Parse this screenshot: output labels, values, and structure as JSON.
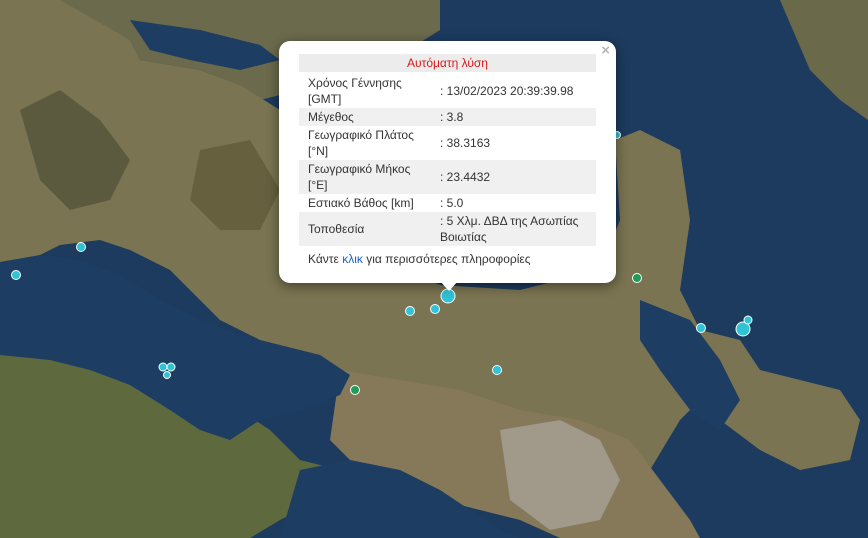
{
  "popup": {
    "title": "Αυτόματη λύση",
    "close_icon": "×",
    "rows": [
      {
        "label": "Χρόνος Γέννησης [GMT]",
        "value": ": 13/02/2023 20:39:39.98"
      },
      {
        "label": "Μέγεθος",
        "value": ": 3.8"
      },
      {
        "label": "Γεωγραφικό Πλάτος [°N]",
        "value": ": 38.3163"
      },
      {
        "label": "Γεωγραφικό Μήκος [°E]",
        "value": ": 23.4432"
      },
      {
        "label": "Εστιακό Βάθος [km]",
        "value": ": 5.0"
      },
      {
        "label": "Τοποθεσία",
        "value": ": 5 Χλμ. ΔΒΔ της Ασωπίας Βοιωτίας"
      }
    ],
    "more_prefix": "Κάντε ",
    "more_link": "κλικ",
    "more_suffix": " για περισσότερες πληροφορίες"
  },
  "colors": {
    "marker_cyan": "#2fc3d6",
    "marker_green": "#1f9c5a",
    "title_red": "#d61a1a",
    "link_blue": "#1a62c9",
    "sea": "#1b3a5c"
  }
}
